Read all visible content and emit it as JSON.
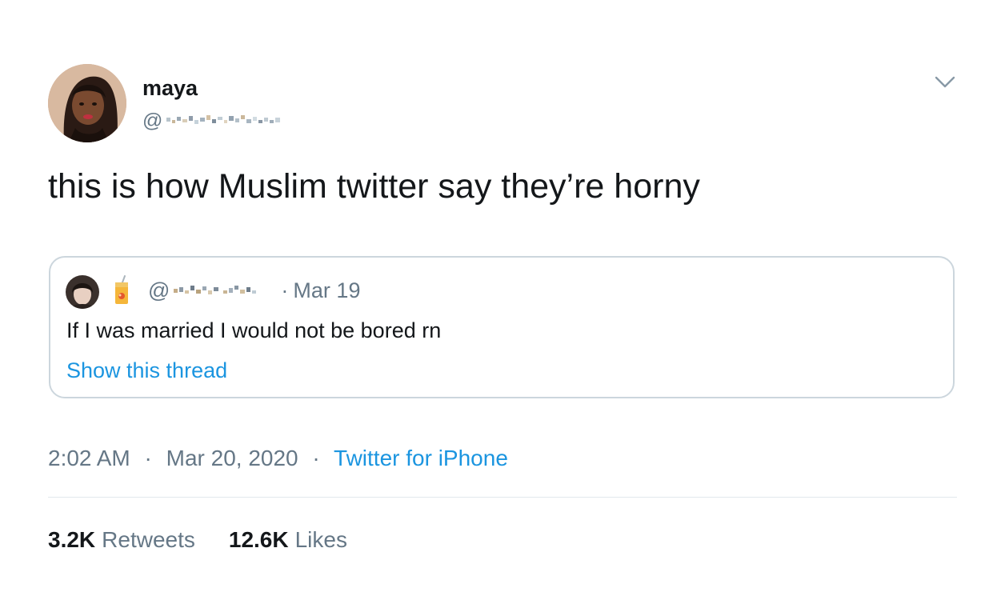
{
  "author": {
    "name": "maya",
    "handle_prefix": "@"
  },
  "tweet": {
    "text": "this is how Muslim twitter say they’re horny"
  },
  "quoted_tweet": {
    "handle_prefix": "@",
    "separator": "·",
    "date": "Mar 19",
    "text": "If I was married I would not be bored rn",
    "thread_link": "Show this thread"
  },
  "meta": {
    "time": "2:02 AM",
    "separator": "·",
    "date": "Mar 20, 2020",
    "source": "Twitter for iPhone"
  },
  "stats": {
    "retweets_count": "3.2K",
    "retweets_label": "Retweets",
    "likes_count": "12.6K",
    "likes_label": "Likes"
  },
  "colors": {
    "link": "#1b95e0",
    "secondary_text": "#657786",
    "border": "#ccd6dd"
  },
  "icons": {
    "menu": "chevron-down-icon",
    "quoted_emoji": "juice-box-emoji-icon"
  }
}
